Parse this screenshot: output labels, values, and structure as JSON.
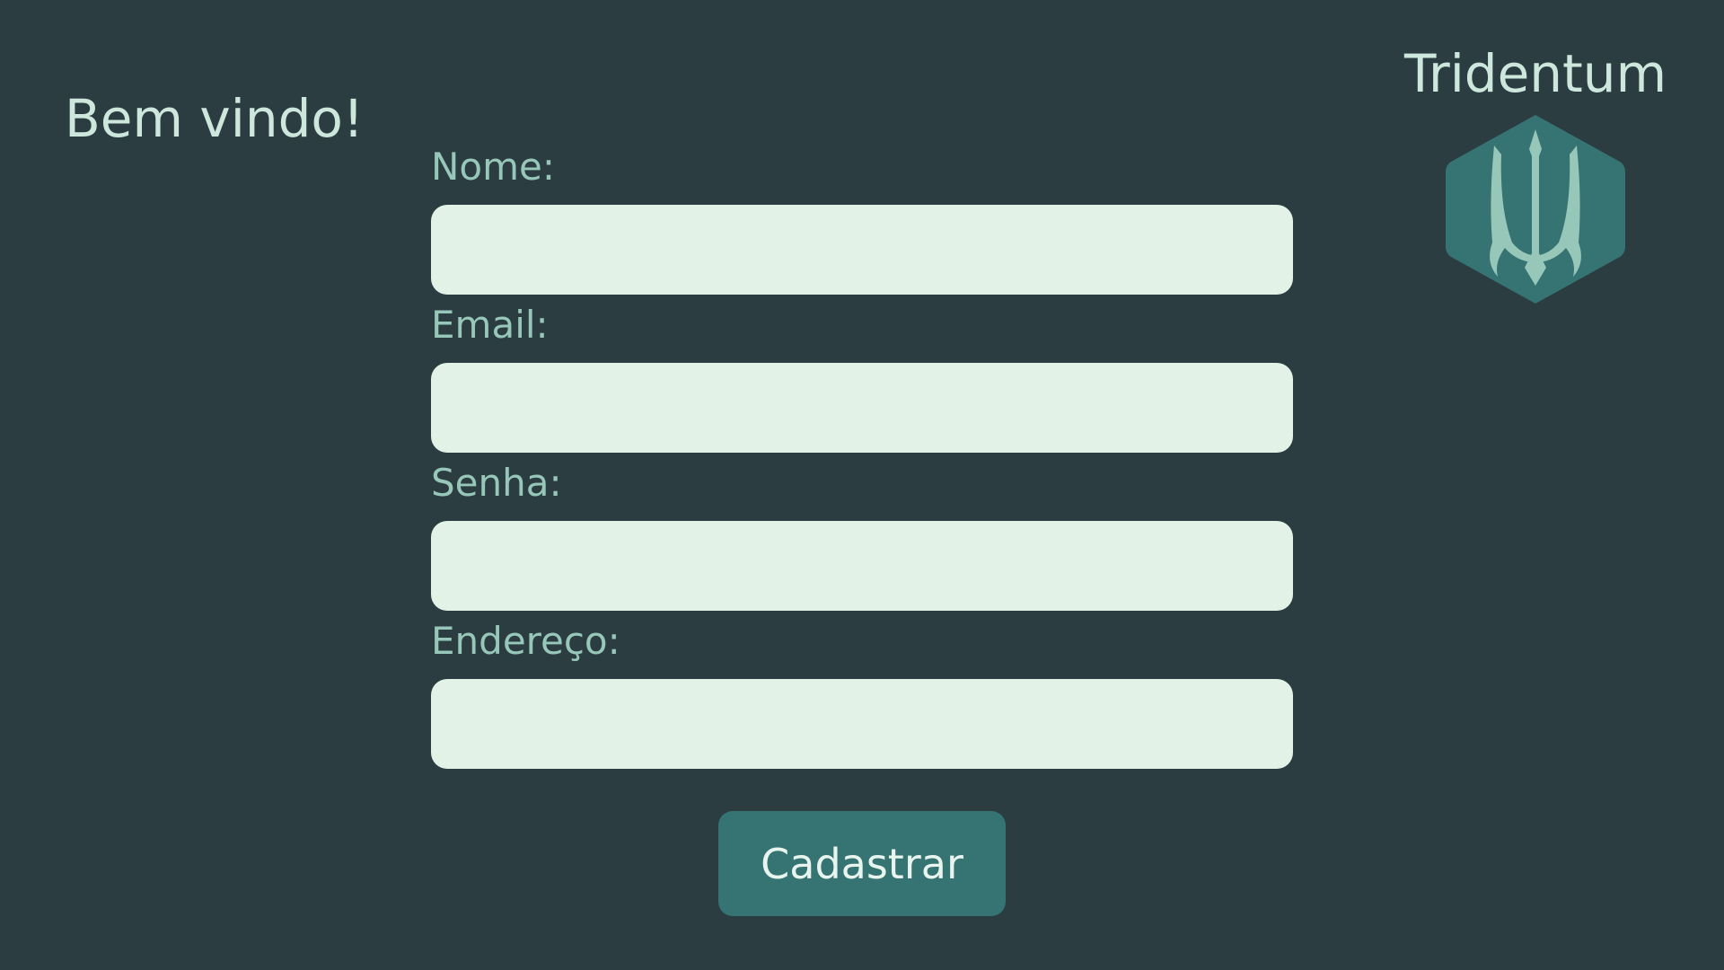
{
  "header": {
    "welcome": "Bem vindo!"
  },
  "brand": {
    "name": "Tridentum",
    "logo_icon": "trident-icon",
    "logo_color": "#367373",
    "logo_mark_color": "#97c7b9"
  },
  "form": {
    "fields": [
      {
        "label": "Nome:",
        "value": "",
        "placeholder": ""
      },
      {
        "label": "Email:",
        "value": "",
        "placeholder": ""
      },
      {
        "label": "Senha:",
        "value": "",
        "placeholder": ""
      },
      {
        "label": "Endereço:",
        "value": "",
        "placeholder": ""
      }
    ],
    "submit_label": "Cadastrar"
  },
  "colors": {
    "background": "#2c3d42",
    "input_background": "#e3f2e7",
    "button": "#367373",
    "label_text": "#97c7b9",
    "heading_text": "#cde7dd"
  }
}
